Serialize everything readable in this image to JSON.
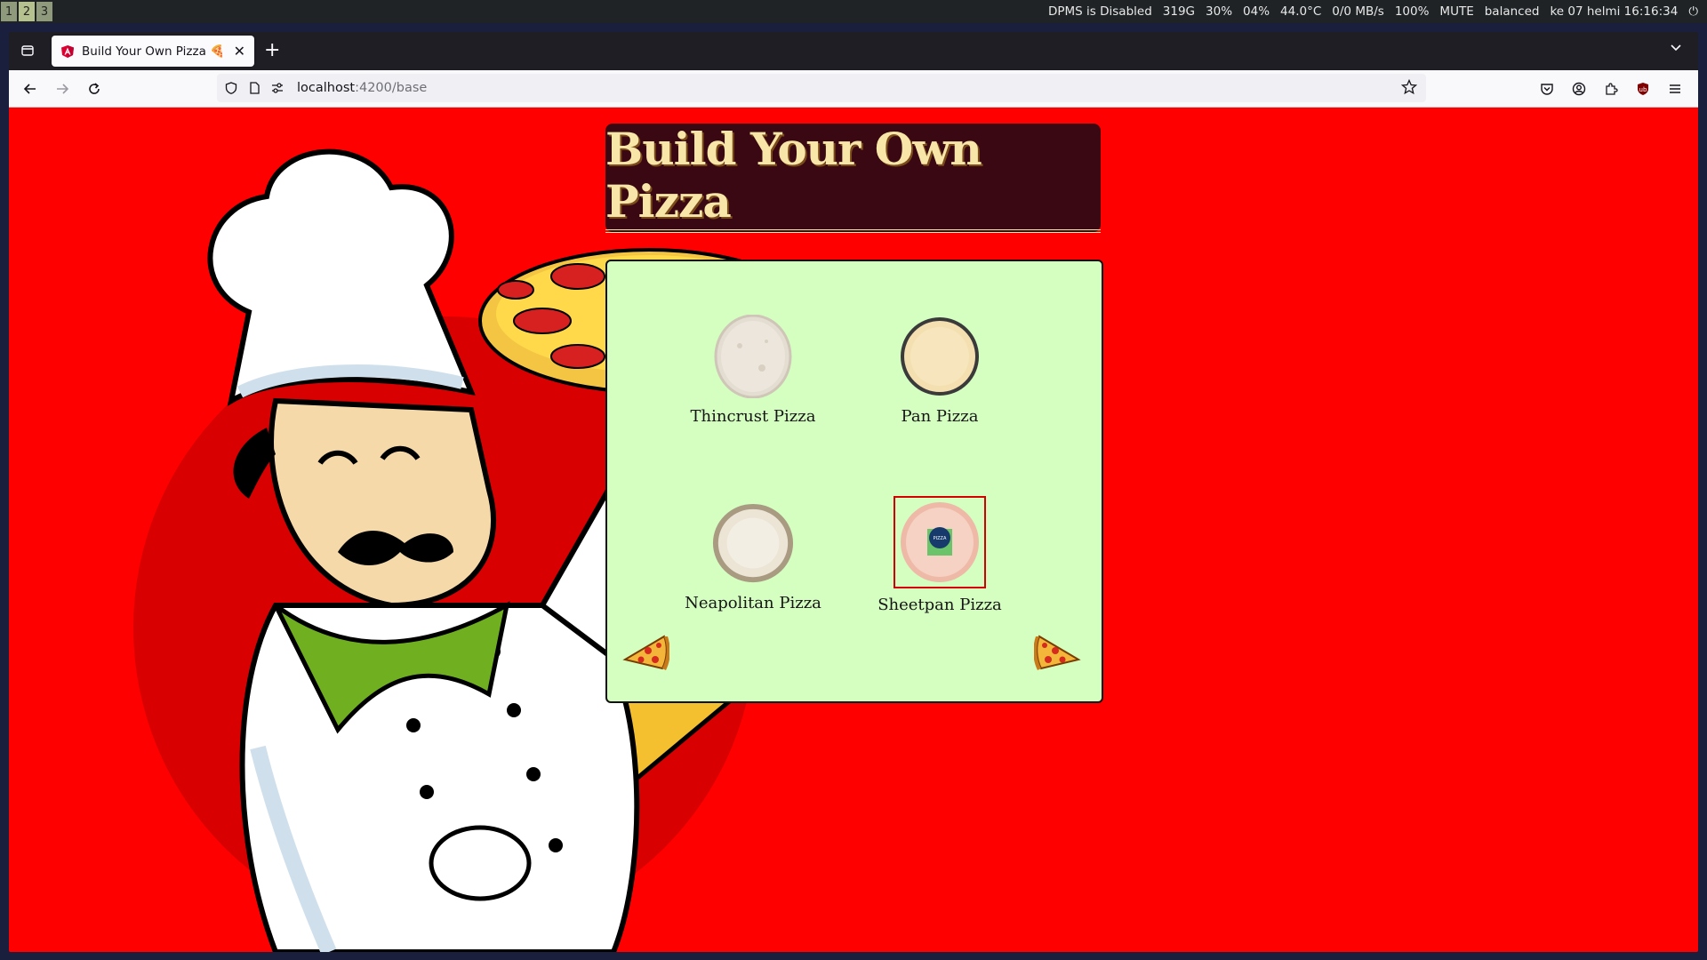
{
  "system_bar": {
    "workspaces": [
      "1",
      "2",
      "3"
    ],
    "active_workspace": "2",
    "status": [
      "DPMS is Disabled",
      "319G",
      "30%",
      "04%",
      "44.0°C",
      "0/0 MB/s",
      "100%",
      "MUTE",
      "balanced",
      "ke 07 helmi 16:16:34"
    ]
  },
  "browser": {
    "tab_title": "Build Your Own Pizza 🍕",
    "url_host": "localhost",
    "url_path": ":4200/base"
  },
  "page": {
    "heading": "Build Your Own Pizza",
    "options": [
      {
        "label": "Thincrust Pizza",
        "selected": false
      },
      {
        "label": "Pan Pizza",
        "selected": false
      },
      {
        "label": "Neapolitan Pizza",
        "selected": false
      },
      {
        "label": "Sheetpan Pizza",
        "selected": true
      }
    ]
  },
  "colors": {
    "page_bg": "#ff0000",
    "panel_bg": "#d4ffc1",
    "title_bg": "#3a0812",
    "title_text": "#f7e6a8",
    "selection_border": "#d40000"
  },
  "icons": [
    "tab-list-icon",
    "angular-favicon",
    "close-icon",
    "plus-icon",
    "chevron-down-icon",
    "back-icon",
    "forward-icon",
    "reload-icon",
    "shield-icon",
    "page-icon",
    "permissions-icon",
    "bookmark-star-icon",
    "pocket-icon",
    "account-icon",
    "extensions-icon",
    "ublock-icon",
    "menu-icon",
    "pizza-slice-left-icon",
    "pizza-slice-right-icon"
  ]
}
